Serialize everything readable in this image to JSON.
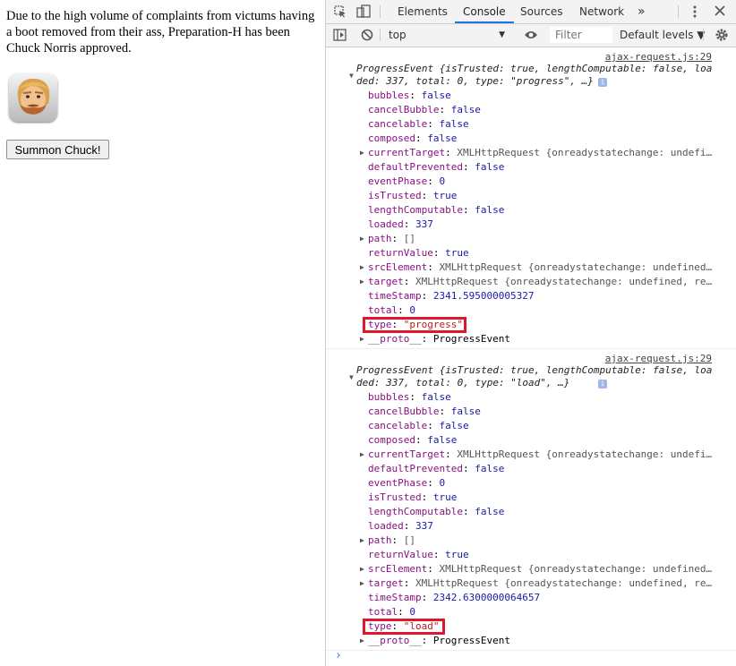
{
  "page": {
    "joke": "Due to the high volume of complaints from victums having a boot removed from their ass, Preparation-H has been Chuck Norris approved.",
    "button_label": "Summon Chuck!"
  },
  "devtools": {
    "tabs": [
      "Elements",
      "Console",
      "Sources",
      "Network"
    ],
    "active_tab": "Console",
    "more_tabs": "»",
    "context": "top",
    "filter_placeholder": "Filter",
    "levels": "Default levels ▼"
  },
  "entries": [
    {
      "source": "ajax-request.js:29",
      "header_lines": [
        "ProgressEvent {isTrusted: true, lengthComputable: false, loa",
        "ded: 337, total: 0, type: \"progress\", …}"
      ],
      "props": [
        {
          "key": "bubbles",
          "value": "false",
          "kind": "bool",
          "expandable": false
        },
        {
          "key": "cancelBubble",
          "value": "false",
          "kind": "bool",
          "expandable": false
        },
        {
          "key": "cancelable",
          "value": "false",
          "kind": "bool",
          "expandable": false
        },
        {
          "key": "composed",
          "value": "false",
          "kind": "bool",
          "expandable": false
        },
        {
          "key": "currentTarget",
          "value": "XMLHttpRequest {onreadystatechange: undefi…",
          "kind": "obj",
          "expandable": true
        },
        {
          "key": "defaultPrevented",
          "value": "false",
          "kind": "bool",
          "expandable": false
        },
        {
          "key": "eventPhase",
          "value": "0",
          "kind": "num",
          "expandable": false
        },
        {
          "key": "isTrusted",
          "value": "true",
          "kind": "bool",
          "expandable": false
        },
        {
          "key": "lengthComputable",
          "value": "false",
          "kind": "bool",
          "expandable": false
        },
        {
          "key": "loaded",
          "value": "337",
          "kind": "num",
          "expandable": false
        },
        {
          "key": "path",
          "value": "[]",
          "kind": "obj",
          "expandable": true
        },
        {
          "key": "returnValue",
          "value": "true",
          "kind": "bool",
          "expandable": false
        },
        {
          "key": "srcElement",
          "value": "XMLHttpRequest {onreadystatechange: undefined…",
          "kind": "obj",
          "expandable": true
        },
        {
          "key": "target",
          "value": "XMLHttpRequest {onreadystatechange: undefined, re…",
          "kind": "obj",
          "expandable": true
        },
        {
          "key": "timeStamp",
          "value": "2341.595000005327",
          "kind": "num",
          "expandable": false
        },
        {
          "key": "total",
          "value": "0",
          "kind": "num",
          "expandable": false
        },
        {
          "key": "type",
          "value": "\"progress\"",
          "kind": "str",
          "expandable": false,
          "highlight": true
        },
        {
          "key": "__proto__",
          "value": "ProgressEvent",
          "kind": "proto",
          "expandable": true
        }
      ]
    },
    {
      "source": "ajax-request.js:29",
      "header_lines": [
        "ProgressEvent {isTrusted: true, lengthComputable: false, loa",
        "ded: 337, total: 0, type: \"load\", …}"
      ],
      "props": [
        {
          "key": "bubbles",
          "value": "false",
          "kind": "bool",
          "expandable": false
        },
        {
          "key": "cancelBubble",
          "value": "false",
          "kind": "bool",
          "expandable": false
        },
        {
          "key": "cancelable",
          "value": "false",
          "kind": "bool",
          "expandable": false
        },
        {
          "key": "composed",
          "value": "false",
          "kind": "bool",
          "expandable": false
        },
        {
          "key": "currentTarget",
          "value": "XMLHttpRequest {onreadystatechange: undefi…",
          "kind": "obj",
          "expandable": true
        },
        {
          "key": "defaultPrevented",
          "value": "false",
          "kind": "bool",
          "expandable": false
        },
        {
          "key": "eventPhase",
          "value": "0",
          "kind": "num",
          "expandable": false
        },
        {
          "key": "isTrusted",
          "value": "true",
          "kind": "bool",
          "expandable": false
        },
        {
          "key": "lengthComputable",
          "value": "false",
          "kind": "bool",
          "expandable": false
        },
        {
          "key": "loaded",
          "value": "337",
          "kind": "num",
          "expandable": false
        },
        {
          "key": "path",
          "value": "[]",
          "kind": "obj",
          "expandable": true
        },
        {
          "key": "returnValue",
          "value": "true",
          "kind": "bool",
          "expandable": false
        },
        {
          "key": "srcElement",
          "value": "XMLHttpRequest {onreadystatechange: undefined…",
          "kind": "obj",
          "expandable": true
        },
        {
          "key": "target",
          "value": "XMLHttpRequest {onreadystatechange: undefined, re…",
          "kind": "obj",
          "expandable": true
        },
        {
          "key": "timeStamp",
          "value": "2342.6300000064657",
          "kind": "num",
          "expandable": false
        },
        {
          "key": "total",
          "value": "0",
          "kind": "num",
          "expandable": false
        },
        {
          "key": "type",
          "value": "\"load\"",
          "kind": "str",
          "expandable": false,
          "highlight": true
        },
        {
          "key": "__proto__",
          "value": "ProgressEvent",
          "kind": "proto",
          "expandable": true
        }
      ]
    }
  ],
  "prompt_symbol": "›"
}
